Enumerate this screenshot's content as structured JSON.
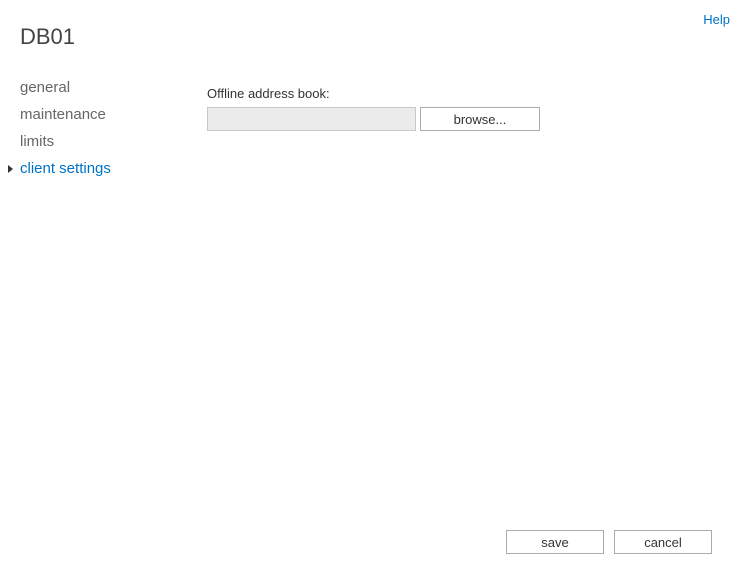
{
  "header": {
    "title": "DB01",
    "help_label": "Help"
  },
  "sidebar": {
    "items": [
      {
        "label": "general"
      },
      {
        "label": "maintenance"
      },
      {
        "label": "limits"
      },
      {
        "label": "client settings"
      }
    ]
  },
  "content": {
    "offline_address_book_label": "Offline address book:",
    "offline_address_book_value": "",
    "browse_label": "browse..."
  },
  "footer": {
    "save_label": "save",
    "cancel_label": "cancel"
  }
}
